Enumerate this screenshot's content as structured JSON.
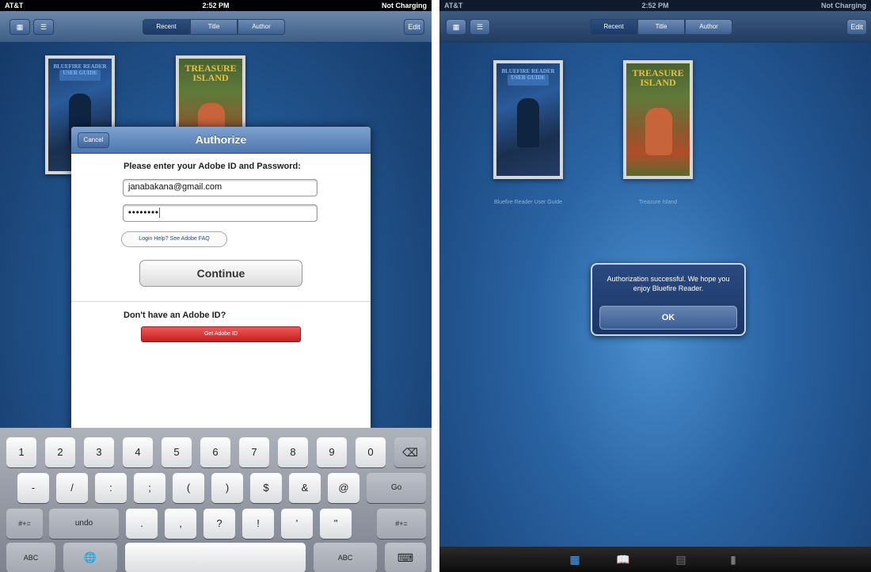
{
  "status": {
    "carrier": "AT&T",
    "time": "2:52 PM",
    "battery": "Not Charging"
  },
  "toolbar": {
    "segments": [
      "Recent",
      "Title",
      "Author"
    ],
    "edit_label": "Edit",
    "grid_icon": "grid-icon",
    "list_icon": "list-icon"
  },
  "books": [
    {
      "cover_title": "BLUEFIRE READER USER GUIDE",
      "label": "Bluefire Reader User Guide"
    },
    {
      "cover_title": "TREASURE ISLAND",
      "label": "Treasure Island"
    }
  ],
  "dialog": {
    "title": "Authorize",
    "cancel_label": "Cancel",
    "prompt": "Please enter your Adobe ID and Password:",
    "email_value": "janabakana@gmail.com",
    "password_mask": "••••••••",
    "help_label": "Login Help? See Adobe FAQ",
    "continue_label": "Continue",
    "no_id_text": "Don't have an Adobe ID?",
    "get_id_label": "Get Adobe ID"
  },
  "keyboard": {
    "row1": [
      "1",
      "2",
      "3",
      "4",
      "5",
      "6",
      "7",
      "8",
      "9",
      "0",
      "⌫"
    ],
    "row2": [
      "-",
      "/",
      ":",
      ";",
      "(",
      ")",
      "$",
      "&",
      "@",
      "Go"
    ],
    "row3": [
      "#+=",
      "undo",
      ".",
      ",",
      "?",
      "!",
      "'",
      "\"",
      "#+="
    ],
    "row4": [
      "ABC",
      "🌐",
      "",
      "ABC",
      "⌨"
    ]
  },
  "alert": {
    "message": "Authorization successful. We hope you enjoy Bluefire Reader.",
    "ok_label": "OK"
  },
  "tabbar": {
    "icons": [
      "library-icon",
      "reading-icon",
      "catalog-icon",
      "info-icon"
    ],
    "glyphs": [
      "▦",
      "📖",
      "▤",
      "▮"
    ]
  },
  "colors": {
    "accent_blue": "#4e78af",
    "danger_red": "#c41e1e",
    "background_blue": "#22558f"
  }
}
